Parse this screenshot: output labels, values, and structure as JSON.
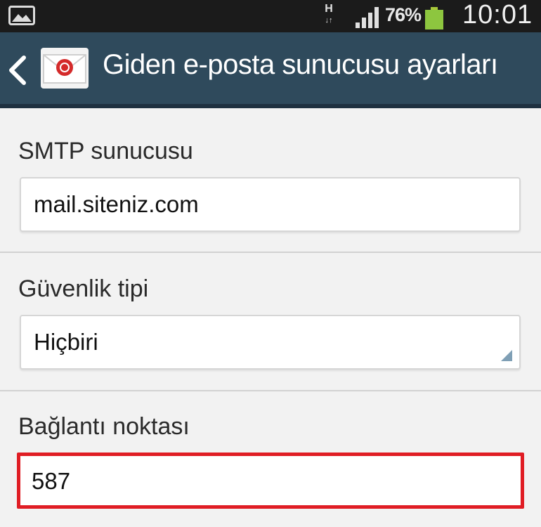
{
  "status_bar": {
    "network_type": "H",
    "battery_percent": "76%",
    "time": "10:01",
    "icons": [
      "gallery-icon",
      "network-activity-icon",
      "signal-icon",
      "battery-icon"
    ],
    "battery_color": "#8dc63f"
  },
  "action_bar": {
    "title": "Giden e-posta sunucusu ayarları",
    "icons": [
      "back-icon",
      "email-app-icon"
    ],
    "background": "#2f4a5c"
  },
  "form": {
    "smtp": {
      "label": "SMTP sunucusu",
      "value": "mail.siteniz.com"
    },
    "security": {
      "label": "Güvenlik tipi",
      "selected": "Hiçbiri"
    },
    "port": {
      "label": "Bağlantı noktası",
      "value": "587",
      "highlight_color": "#e01d24"
    }
  }
}
